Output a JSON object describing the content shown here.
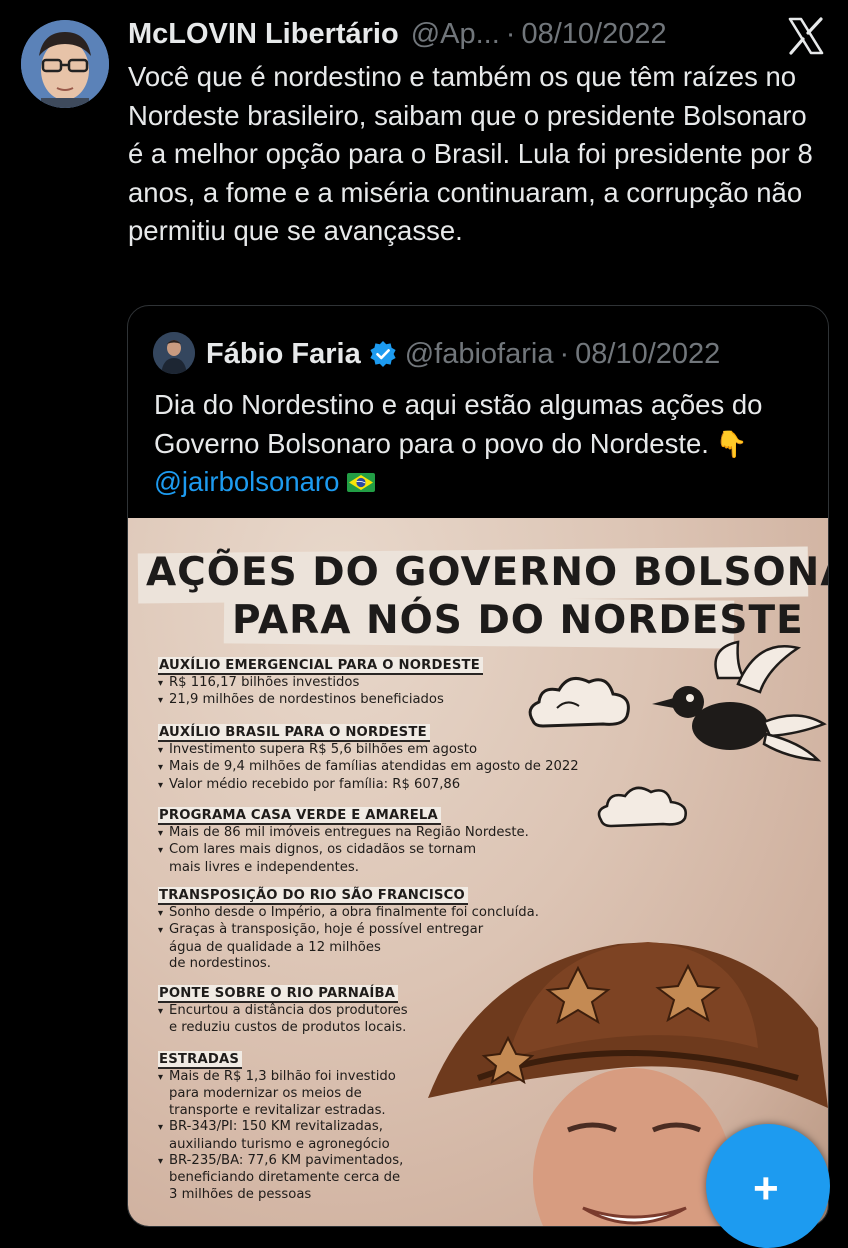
{
  "tweet": {
    "author_name": "McLOVIN Libertário",
    "author_handle": "@Ap...",
    "separator": "·",
    "date": "08/10/2022",
    "text": "Você que é nordestino e também os que têm raízes no Nordeste brasileiro, saibam que o presidente Bolsonaro é a melhor opção para o Brasil. Lula foi presidente por 8 anos, a fome e a miséria continuaram, a corrupção não permitiu que se avançasse."
  },
  "quote": {
    "author_name": "Fábio Faria",
    "author_handle": "@fabiofaria",
    "separator": "·",
    "date": "08/10/2022",
    "text_before": "Dia do Nordestino e aqui estão algumas ações do Governo Bolsonaro para o povo do Nordeste.",
    "emoji": "👇",
    "mention": "@jairbolsonaro"
  },
  "infographic": {
    "title_line1": "AÇÕES DO GOVERNO BOLSONARO",
    "title_line2": "PARA NÓS DO NORDESTE",
    "sections": [
      {
        "title": "AUXÍLIO EMERGENCIAL PARA O NORDESTE",
        "lines": [
          "R$ 116,17 bilhões investidos",
          "21,9 milhões de nordestinos beneficiados"
        ]
      },
      {
        "title": "AUXÍLIO BRASIL PARA O NORDESTE",
        "lines": [
          "Investimento supera R$ 5,6 bilhões em agosto",
          "Mais de 9,4 milhões de famílias atendidas em agosto de 2022",
          "Valor médio recebido por família: R$ 607,86"
        ]
      },
      {
        "title": "PROGRAMA CASA VERDE E AMARELA",
        "lines": [
          "Mais de 86 mil imóveis entregues na Região Nordeste.",
          "Com lares mais dignos, os cidadãos se tornam",
          "mais livres e independentes."
        ]
      },
      {
        "title": "TRANSPOSIÇÃO DO RIO SÃO FRANCISCO",
        "lines": [
          "Sonho desde o Império, a obra finalmente foi concluída.",
          "Graças à transposição, hoje é possível entregar",
          "água de qualidade a 12 milhões",
          "de nordestinos."
        ]
      },
      {
        "title": "PONTE SOBRE O RIO PARNAÍBA",
        "lines": [
          "Encurtou a distância dos produtores",
          "e reduziu custos de produtos locais."
        ]
      },
      {
        "title": "ESTRADAS",
        "lines": [
          "Mais de R$ 1,3 bilhão foi investido",
          "para modernizar os meios de",
          "transporte e revitalizar estradas.",
          "BR-343/PI: 150 KM revitalizadas,",
          "auxiliando turismo e agronegócio",
          "BR-235/BA: 77,6 KM pavimentados,",
          "beneficiando diretamente cerca de",
          "3 milhões de pessoas"
        ]
      }
    ]
  },
  "fab": {
    "label": "+"
  },
  "colors": {
    "background": "#000000",
    "text": "#e7e9ea",
    "muted": "#71767b",
    "accent": "#1d9bf0"
  }
}
